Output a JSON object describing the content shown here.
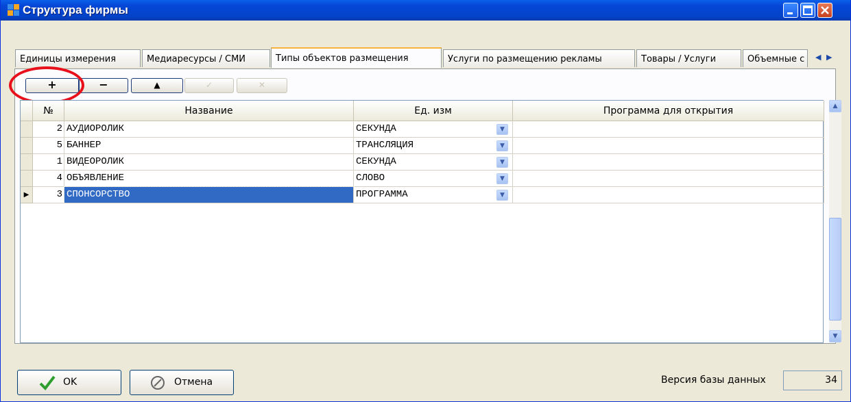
{
  "window": {
    "title": "Структура фирмы"
  },
  "tabs": [
    {
      "label": "Единицы измерения",
      "active": false
    },
    {
      "label": "Медиаресурсы / СМИ",
      "active": false
    },
    {
      "label": "Типы объектов размещения",
      "active": true
    },
    {
      "label": "Услуги по размещению рекламы",
      "active": false
    },
    {
      "label": "Товары / Услуги",
      "active": false
    },
    {
      "label": "Объемные с",
      "active": false
    }
  ],
  "toolbar": {
    "add_label": "+",
    "remove_label": "−",
    "up_label": "▲",
    "edit_label": "✓",
    "cancel_label": "✕"
  },
  "grid": {
    "columns": [
      "№",
      "Название",
      "Ед. изм",
      "Программа для открытия"
    ],
    "rows": [
      {
        "num": "2",
        "name": "АУДИОРОЛИК",
        "unit": "СЕКУНДА",
        "program": "",
        "selected": false
      },
      {
        "num": "5",
        "name": "БАННЕР",
        "unit": "ТРАНСЛЯЦИЯ",
        "program": "",
        "selected": false
      },
      {
        "num": "1",
        "name": "ВИДЕОРОЛИК",
        "unit": "СЕКУНДА",
        "program": "",
        "selected": false
      },
      {
        "num": "4",
        "name": "ОБЪЯВЛЕНИЕ",
        "unit": "СЛОВО",
        "program": "",
        "selected": false
      },
      {
        "num": "3",
        "name": "СПОНСОРСТВО",
        "unit": "ПРОГРАММА",
        "program": "",
        "selected": true
      }
    ]
  },
  "footer": {
    "ok_label": "OK",
    "cancel_label": "Отмена",
    "db_version_label": "Версия базы данных",
    "db_version_value": "34"
  },
  "colors": {
    "titlebar": "#0546d6",
    "selection": "#316ac5",
    "highlight_circle": "#e8101a",
    "active_tab_accent": "#f9b33d"
  }
}
